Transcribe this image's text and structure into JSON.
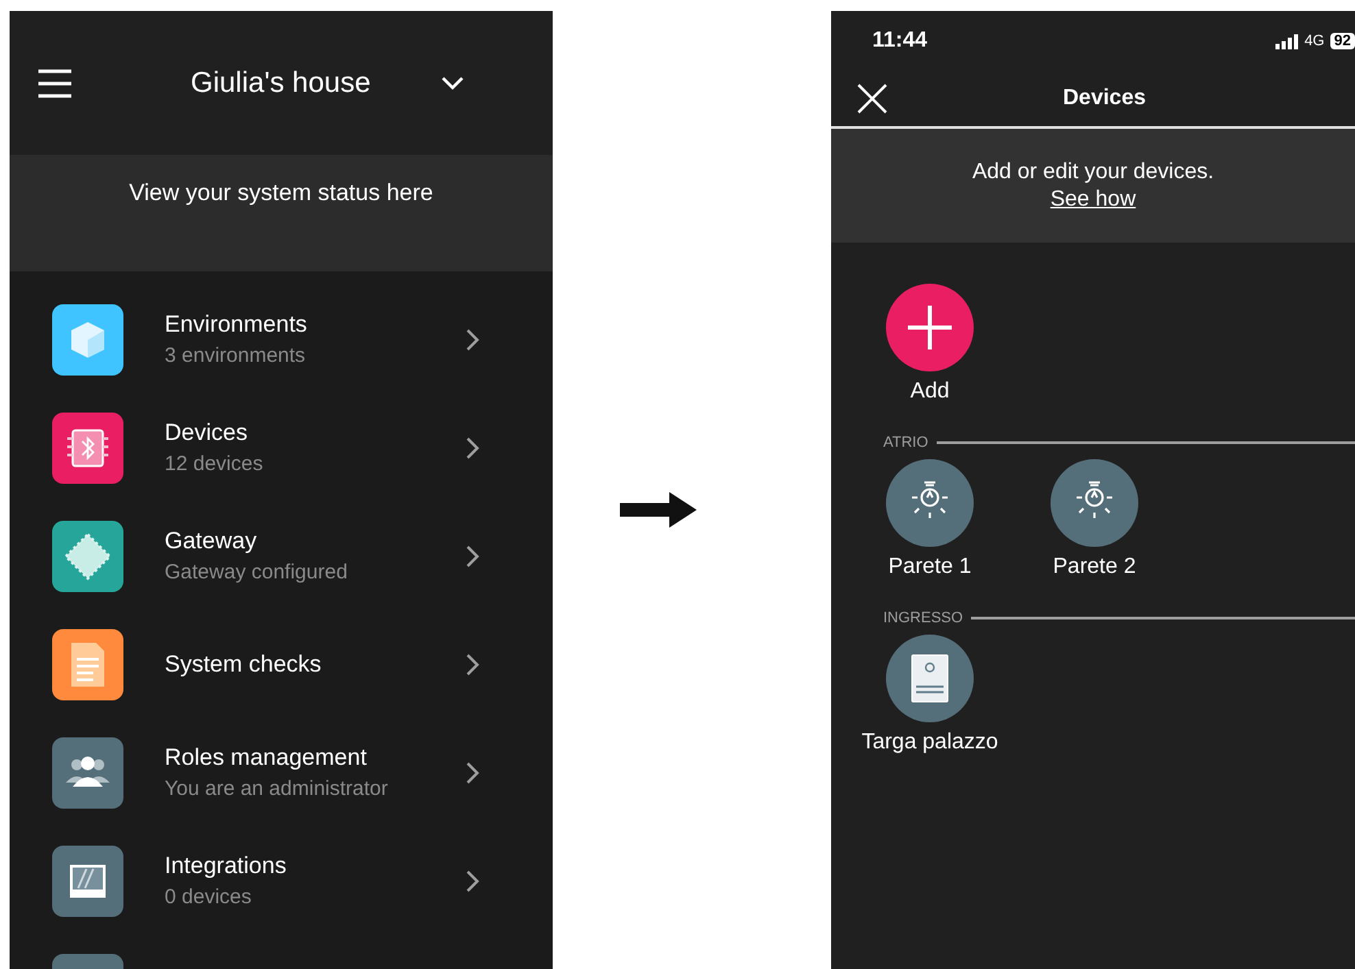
{
  "left_screen": {
    "header": {
      "title": "Giulia's house"
    },
    "banner": "View your system status here",
    "items": [
      {
        "kind": "cube",
        "color": "#40c4ff",
        "title": "Environments",
        "subtitle": "3 environments"
      },
      {
        "kind": "chip",
        "color": "#e91e63",
        "title": "Devices",
        "subtitle": "12 devices"
      },
      {
        "kind": "gateway",
        "color": "#26a69a",
        "title": "Gateway",
        "subtitle": "Gateway configured"
      },
      {
        "kind": "document",
        "color": "#ff8a3d",
        "title": "System checks"
      },
      {
        "kind": "people",
        "color": "#546e7a",
        "title": "Roles management",
        "subtitle": "You are an administrator"
      },
      {
        "kind": "picture",
        "color": "#546e7a",
        "title": "Integrations",
        "subtitle": "0 devices"
      },
      {
        "kind": "blank",
        "color": "#546e7a"
      }
    ]
  },
  "right_screen": {
    "status_bar": {
      "time": "11:44",
      "network": "4G",
      "battery": "92"
    },
    "nav": {
      "title": "Devices"
    },
    "banner": {
      "text": "Add or edit your devices.",
      "link": "See how"
    },
    "add_button": {
      "label": "Add"
    },
    "sections": [
      {
        "name": "ATRIO",
        "devices": [
          {
            "kind": "lamp",
            "label": "Parete 1"
          },
          {
            "kind": "lamp",
            "label": "Parete 2"
          }
        ]
      },
      {
        "name": "INGRESSO",
        "devices": [
          {
            "kind": "panel",
            "label": "Targa palazzo"
          }
        ]
      }
    ]
  }
}
